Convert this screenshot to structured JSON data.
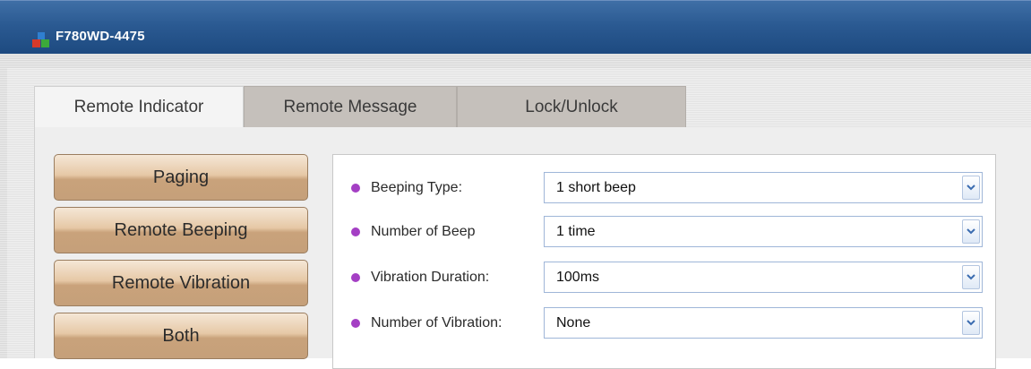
{
  "window": {
    "title": "F780WD-4475",
    "icon": "colored-blocks-app-icon"
  },
  "tabs": [
    {
      "label": "Remote Indicator",
      "active": true
    },
    {
      "label": "Remote Message",
      "active": false
    },
    {
      "label": "Lock/Unlock",
      "active": false
    }
  ],
  "sidebar": {
    "items": [
      {
        "label": "Paging"
      },
      {
        "label": "Remote Beeping"
      },
      {
        "label": "Remote Vibration"
      },
      {
        "label": "Both"
      }
    ]
  },
  "settings": {
    "rows": [
      {
        "label": "Beeping Type:",
        "value": "1 short beep"
      },
      {
        "label": "Number of Beep",
        "value": "1 time"
      },
      {
        "label": "Vibration Duration:",
        "value": "100ms"
      },
      {
        "label": "Number of Vibration:",
        "value": "None"
      }
    ]
  },
  "colors": {
    "titlebar": "#2b5a92",
    "bullet": "#a43fc4",
    "button": "#d9b58e",
    "inactive_tab": "#c5c0bb"
  }
}
